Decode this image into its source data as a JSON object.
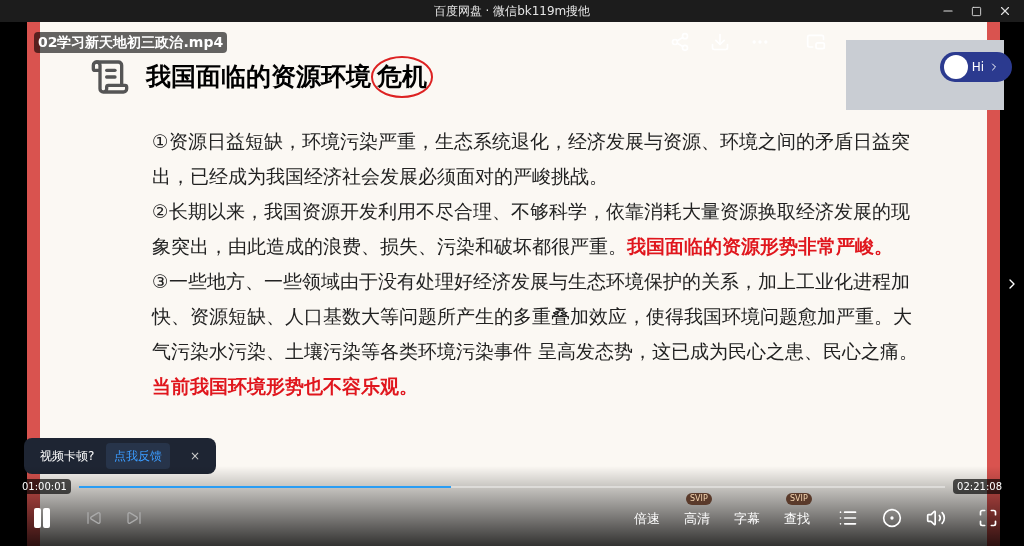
{
  "window": {
    "title": "百度网盘 · 微信bk119m搜他"
  },
  "video": {
    "file_name": "02学习新天地初三政治.mp4",
    "assistant_label": "Hi"
  },
  "slide": {
    "title": [
      {
        "text": "我国面临的资源环境",
        "circled": false
      },
      {
        "text": "危机",
        "circled": true
      }
    ],
    "paragraphs": [
      [
        {
          "text": "①资源日益短缺，环境污染严重，生态系统退化，经济发展与资源、环境之间的矛盾日益突出，已经成为我国经济社会发展必须面对的严峻挑战。",
          "emphasis": false
        }
      ],
      [
        {
          "text": "②长期以来，我国资源开发利用不尽合理、不够科学，依靠消耗大量资源换取经济发展的现象突出，由此造成的浪费、损失、污染和破坏都很严重。",
          "emphasis": false
        },
        {
          "text": "我国面临的资源形势非常严峻。",
          "emphasis": true
        }
      ],
      [
        {
          "text": "③一些地方、一些领域由于没有处理好经济发展与生态环境保护的关系，加上工业化进程加快、资源短缺、人口基数大等问题所产生的多重叠加效应，使得我国环境问题愈加严重。大气污染水污染、土壤污染等各类环境污染事件 呈高发态势，这已成为民心之患、民心之痛。 ",
          "emphasis": false
        },
        {
          "text": "当前我国环境形势也不容乐观。",
          "emphasis": true
        }
      ]
    ]
  },
  "feedback": {
    "message": "视频卡顿?",
    "action": "点我反馈",
    "close": "×"
  },
  "progress": {
    "current": "01:00:01",
    "total": "02:21:08",
    "level": 0.43
  },
  "controls": [
    {
      "label": "倍速"
    },
    {
      "label": "高清",
      "badge": "SVIP"
    },
    {
      "label": "字幕"
    },
    {
      "label": "查找",
      "badge": "SVIP"
    }
  ]
}
